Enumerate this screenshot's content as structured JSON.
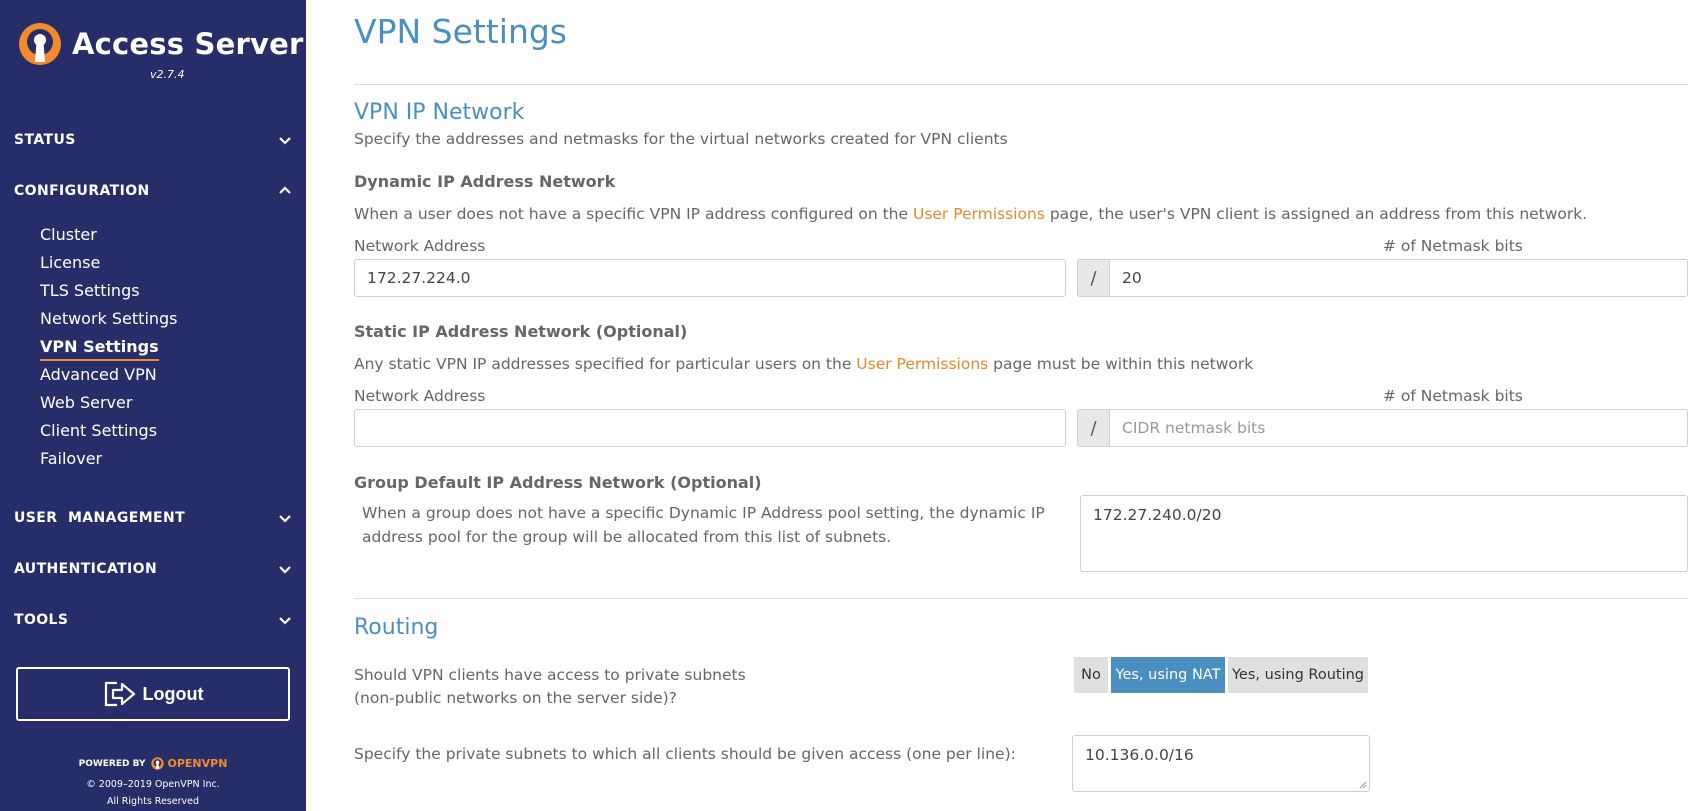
{
  "sidebar": {
    "logo_title": "Access Server",
    "version": "v2.7.4",
    "sections": {
      "status": "STATUS",
      "configuration": "CONFIGURATION",
      "user_management": "USER  MANAGEMENT",
      "authentication": "AUTHENTICATION",
      "tools": "TOOLS"
    },
    "config_items": [
      "Cluster",
      "License",
      "TLS Settings",
      "Network Settings",
      "VPN Settings",
      "Advanced VPN",
      "Web Server",
      "Client Settings",
      "Failover"
    ],
    "active_item": "VPN Settings",
    "logout_label": "Logout",
    "powered_by": "POWERED BY",
    "powered_brand": "OPENVPN",
    "copyright": "© 2009–2019 OpenVPN Inc.",
    "rights": "All Rights Reserved"
  },
  "main": {
    "page_title": "VPN Settings",
    "vpn_ip_network": {
      "title": "VPN IP Network",
      "description": "Specify the addresses and netmasks for the virtual networks created for VPN clients"
    },
    "dynamic": {
      "heading": "Dynamic IP Address Network",
      "desc_before": "When a user does not have a specific VPN IP address configured on the ",
      "desc_link": "User Permissions",
      "desc_after": " page, the user's VPN client is assigned an address from this network.",
      "network_label": "Network Address",
      "network_value": "172.27.224.0",
      "netmask_label": "# of Netmask bits",
      "netmask_value": "20",
      "slash": "/"
    },
    "static": {
      "heading": "Static IP Address Network (Optional)",
      "desc_before": "Any static VPN IP addresses specified for particular users on the ",
      "desc_link": "User Permissions",
      "desc_after": " page must be within this network",
      "network_label": "Network Address",
      "network_value": "",
      "netmask_label": "# of Netmask bits",
      "netmask_placeholder": "CIDR netmask bits",
      "slash": "/"
    },
    "group_default": {
      "heading": "Group Default IP Address Network (Optional)",
      "desc_line1": "When a group does not have a specific Dynamic IP Address pool setting, the dynamic IP",
      "desc_line2": "address pool for the group will be allocated from this list of subnets.",
      "value": "172.27.240.0/20"
    },
    "routing": {
      "title": "Routing",
      "question_line1": "Should VPN clients have access to private subnets",
      "question_line2": "(non-public networks on the server side)?",
      "options": [
        "No",
        "Yes, using NAT",
        "Yes, using Routing"
      ],
      "selected": "Yes, using NAT",
      "subnets_label": "Specify the private subnets to which all clients should be given access (one per line):",
      "subnets_value": "10.136.0.0/16"
    }
  },
  "colors": {
    "sidebar_bg": "#272d68",
    "accent_orange": "#f18b2d",
    "title_blue": "#4a8fc0",
    "link_orange": "#e08a2b"
  }
}
